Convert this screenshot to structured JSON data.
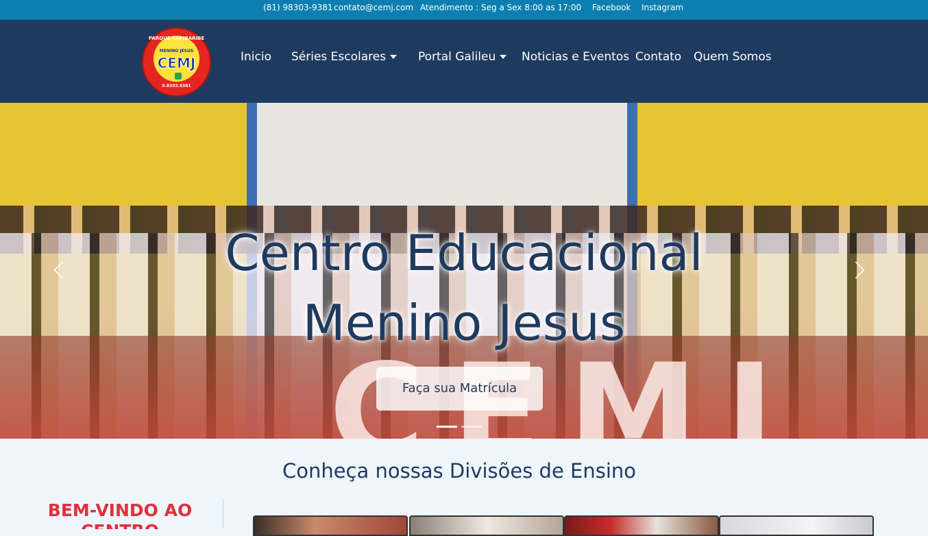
{
  "topbar": {
    "phone": "(81) 98303-9381",
    "email": "contato@cemj.com",
    "hours": "Atendimento : Seg a Sex 8:00 as 17:00",
    "facebook": "Facebook",
    "instagram": "Instagram"
  },
  "logo": {
    "top_text": "PARQUE CAPIBARIBE",
    "sub_text": "MENINO JESUS",
    "main_text": "CEMJ",
    "bottom_text": "9.8303.9381"
  },
  "nav": {
    "items": [
      {
        "label": "Inicio"
      },
      {
        "label": "Séries Escolares"
      },
      {
        "label": "Portal Galileu"
      },
      {
        "label": "Noticias e Eventos"
      },
      {
        "label": "Contato"
      },
      {
        "label": "Quem Somos"
      }
    ]
  },
  "hero": {
    "title_line1": "Centro Educacional",
    "title_line2": "Menino Jesus",
    "button_label": "Faça sua Matrícula",
    "bg_letters": "CEMJ",
    "slide_count": 2,
    "active_slide": 1
  },
  "main": {
    "section_title": "Conheça nossas Divisões de Ensino",
    "welcome_line1": "BEM-VINDO AO",
    "welcome_line2": "CENTRO"
  },
  "colors": {
    "topbar": "#0c7fb0",
    "navbar": "#1f3a5f",
    "accent_red": "#e0303a"
  }
}
